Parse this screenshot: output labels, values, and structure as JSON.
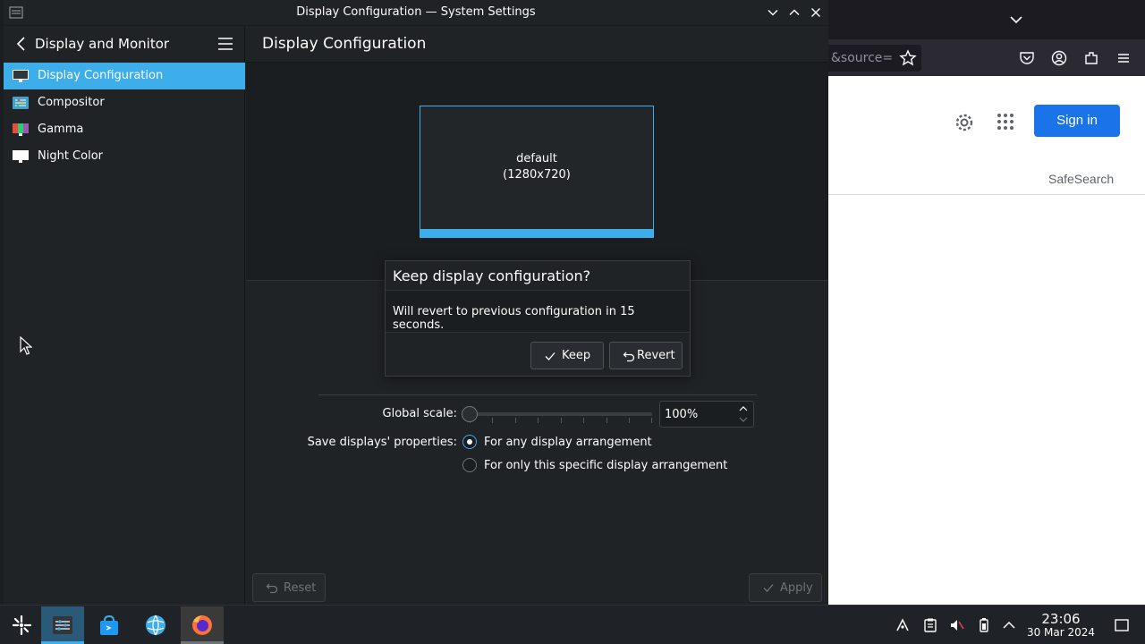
{
  "window": {
    "title": "Display Configuration — System Settings"
  },
  "sidebar": {
    "header": "Display and Monitor",
    "items": [
      {
        "label": "Display Configuration",
        "icon": "monitor-icon",
        "selected": true
      },
      {
        "label": "Compositor",
        "icon": "compositor-icon",
        "selected": false
      },
      {
        "label": "Gamma",
        "icon": "gamma-icon",
        "selected": false
      },
      {
        "label": "Night Color",
        "icon": "night-color-icon",
        "selected": false
      }
    ]
  },
  "main": {
    "title": "Display Configuration",
    "output": {
      "name": "default",
      "resolution": "(1280x720)"
    },
    "global_scale_label": "Global scale:",
    "global_scale_value": "100%",
    "save_props_label": "Save displays' properties:",
    "radio_options": [
      {
        "label": "For any display arrangement",
        "checked": true
      },
      {
        "label": "For only this specific display arrangement",
        "checked": false
      }
    ],
    "reset_label": "Reset",
    "apply_label": "Apply"
  },
  "dialog": {
    "title": "Keep display configuration?",
    "message": "Will revert to previous configuration in 15 seconds.",
    "keep_label": "Keep",
    "revert_label": "Revert"
  },
  "firefox": {
    "url_fragment": "&source=",
    "sign_in_label": "Sign in",
    "safesearch_label": "SafeSearch"
  },
  "taskbar": {
    "time": "23:06",
    "date": "30 Mar 2024"
  },
  "colors": {
    "accent": "#3daee9",
    "window_bg": "#202326",
    "google_blue": "#1a73e8"
  }
}
